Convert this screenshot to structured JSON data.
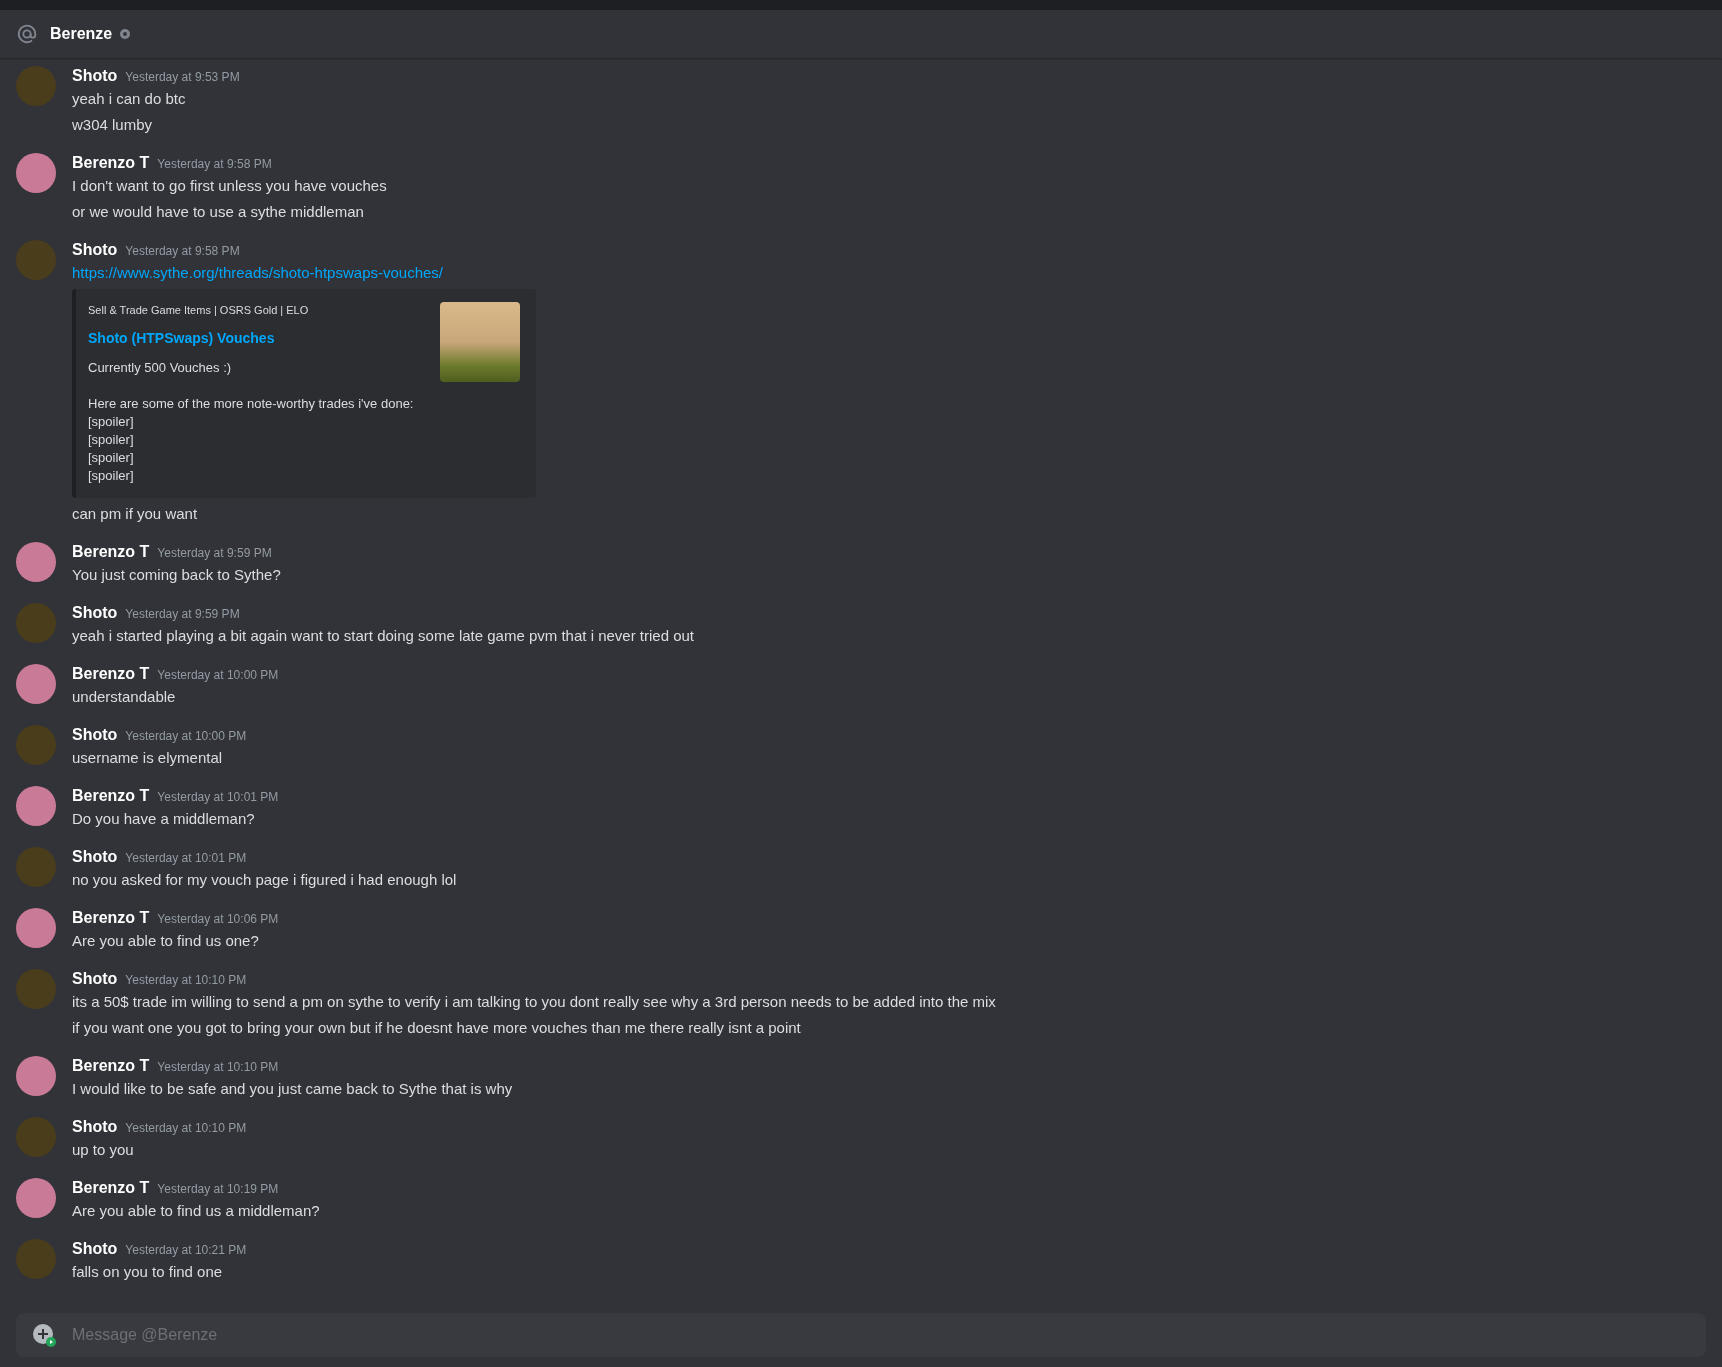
{
  "header": {
    "name": "Berenze",
    "online": false
  },
  "messages": [
    {
      "author": "Shoto",
      "color": "#4a3d1c",
      "time": "Yesterday at 9:53 PM",
      "lines": [
        {
          "kind": "text",
          "text": "yeah i can do btc"
        },
        {
          "kind": "text",
          "text": "w304 lumby"
        }
      ]
    },
    {
      "author": "Berenzo T",
      "color": "#c97a97",
      "time": "Yesterday at 9:58 PM",
      "lines": [
        {
          "kind": "text",
          "text": "I don't want to go first unless you have vouches"
        },
        {
          "kind": "text",
          "text": "or we would have to use a sythe middleman"
        }
      ]
    },
    {
      "author": "Shoto",
      "color": "#4a3d1c",
      "time": "Yesterday at 9:58 PM",
      "lines": [
        {
          "kind": "link",
          "text": "https://www.sythe.org/threads/shoto-htpswaps-vouches/"
        },
        {
          "kind": "embed",
          "provider": "Sell & Trade Game Items | OSRS Gold | ELO",
          "title": "Shoto (HTPSwaps) Vouches",
          "description": "Currently 500 Vouches :)",
          "body": [
            "Here are some of the more note-worthy trades i've done:",
            "[spoiler]",
            "[spoiler]",
            "[spoiler]",
            "[spoiler]"
          ]
        },
        {
          "kind": "text",
          "text": "can pm if you want"
        }
      ]
    },
    {
      "author": "Berenzo T",
      "color": "#c97a97",
      "time": "Yesterday at 9:59 PM",
      "lines": [
        {
          "kind": "text",
          "text": "You just coming back to Sythe?"
        }
      ]
    },
    {
      "author": "Shoto",
      "color": "#4a3d1c",
      "time": "Yesterday at 9:59 PM",
      "lines": [
        {
          "kind": "text",
          "text": "yeah i started playing a bit again want to start doing some late game pvm that i never tried out"
        }
      ]
    },
    {
      "author": "Berenzo T",
      "color": "#c97a97",
      "time": "Yesterday at 10:00 PM",
      "lines": [
        {
          "kind": "text",
          "text": "understandable"
        }
      ]
    },
    {
      "author": "Shoto",
      "color": "#4a3d1c",
      "time": "Yesterday at 10:00 PM",
      "lines": [
        {
          "kind": "text",
          "text": "username is elymental"
        }
      ]
    },
    {
      "author": "Berenzo T",
      "color": "#c97a97",
      "time": "Yesterday at 10:01 PM",
      "lines": [
        {
          "kind": "text",
          "text": "Do you have a middleman?"
        }
      ]
    },
    {
      "author": "Shoto",
      "color": "#4a3d1c",
      "time": "Yesterday at 10:01 PM",
      "lines": [
        {
          "kind": "text",
          "text": "no you asked for my vouch page i figured i had enough lol"
        }
      ]
    },
    {
      "author": "Berenzo T",
      "color": "#c97a97",
      "time": "Yesterday at 10:06 PM",
      "lines": [
        {
          "kind": "text",
          "text": "Are you able to find us one?"
        }
      ]
    },
    {
      "author": "Shoto",
      "color": "#4a3d1c",
      "time": "Yesterday at 10:10 PM",
      "lines": [
        {
          "kind": "text",
          "text": "its a 50$ trade im willing to send a pm on sythe to verify i am talking to you dont really see why a 3rd person needs to be added into the mix"
        },
        {
          "kind": "text",
          "text": "if you want one you got to bring your own but if he doesnt have more vouches than me there really isnt a point"
        }
      ]
    },
    {
      "author": "Berenzo T",
      "color": "#c97a97",
      "time": "Yesterday at 10:10 PM",
      "lines": [
        {
          "kind": "text",
          "text": "I would like to be safe and you just came back to Sythe that is why"
        }
      ]
    },
    {
      "author": "Shoto",
      "color": "#4a3d1c",
      "time": "Yesterday at 10:10 PM",
      "lines": [
        {
          "kind": "text",
          "text": "up to you"
        }
      ]
    },
    {
      "author": "Berenzo T",
      "color": "#c97a97",
      "time": "Yesterday at 10:19 PM",
      "lines": [
        {
          "kind": "text",
          "text": "Are you able to find us a middleman?"
        }
      ]
    },
    {
      "author": "Shoto",
      "color": "#4a3d1c",
      "time": "Yesterday at 10:21 PM",
      "lines": [
        {
          "kind": "text",
          "text": "falls on you to find one"
        }
      ]
    }
  ],
  "composer": {
    "placeholder": "Message @Berenze"
  }
}
